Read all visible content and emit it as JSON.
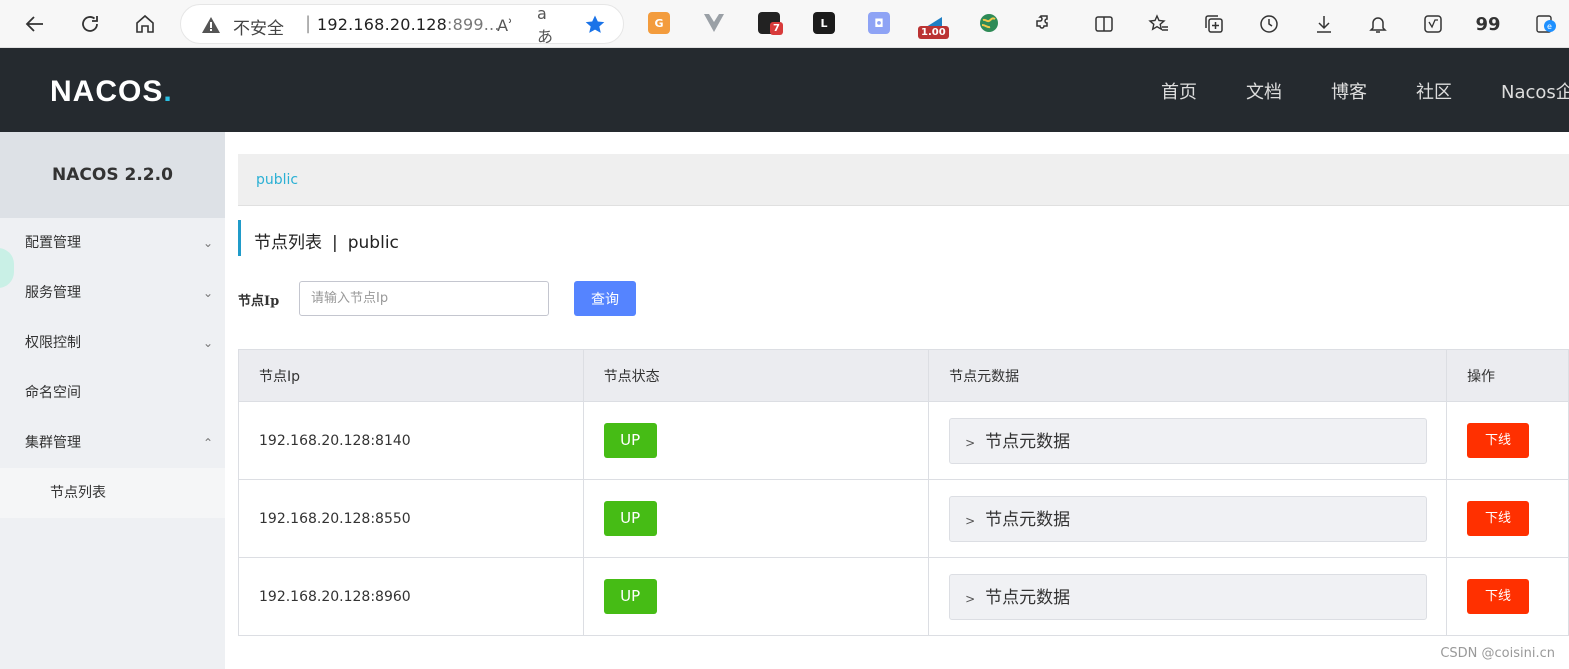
{
  "browser": {
    "insecure_label": "不安全",
    "separator": "|",
    "url_main": "192.168.20.128",
    "url_rest": ":899...",
    "read_aloud_label": "Aʾ",
    "translate_label": "aあ",
    "ext_badge_count": "7",
    "ext_rate": "1.00",
    "quote_label": "99"
  },
  "header": {
    "logo_main": "NACOS",
    "logo_dot": ".",
    "nav": [
      "首页",
      "文档",
      "博客",
      "社区",
      "Nacos企"
    ]
  },
  "sidebar": {
    "version": "NACOS 2.2.0",
    "items": [
      {
        "label": "配置管理",
        "chevron": "down"
      },
      {
        "label": "服务管理",
        "chevron": "down"
      },
      {
        "label": "权限控制",
        "chevron": "down"
      },
      {
        "label": "命名空间",
        "chevron": ""
      },
      {
        "label": "集群管理",
        "chevron": "up"
      }
    ],
    "sub_items": [
      "节点列表"
    ]
  },
  "namespace": {
    "current": "public"
  },
  "page": {
    "title": "节点列表",
    "title_sep": "|",
    "namespace": "public"
  },
  "filter": {
    "label": "节点Ip",
    "placeholder": "请输入节点Ip",
    "value": "",
    "button": "查询"
  },
  "table": {
    "columns": [
      "节点Ip",
      "节点状态",
      "节点元数据",
      "操作"
    ],
    "rows": [
      {
        "ip": "192.168.20.128:8140",
        "status": "UP",
        "metadata": "节点元数据",
        "action": "下线"
      },
      {
        "ip": "192.168.20.128:8550",
        "status": "UP",
        "metadata": "节点元数据",
        "action": "下线"
      },
      {
        "ip": "192.168.20.128:8960",
        "status": "UP",
        "metadata": "节点元数据",
        "action": "下线"
      }
    ]
  },
  "watermark": "CSDN @coisini.cn",
  "colors": {
    "header_bg": "#252a2f",
    "accent": "#2bb0d4",
    "up": "#46bc15",
    "offline": "#ff3000",
    "primary_btn": "#5584ff"
  }
}
